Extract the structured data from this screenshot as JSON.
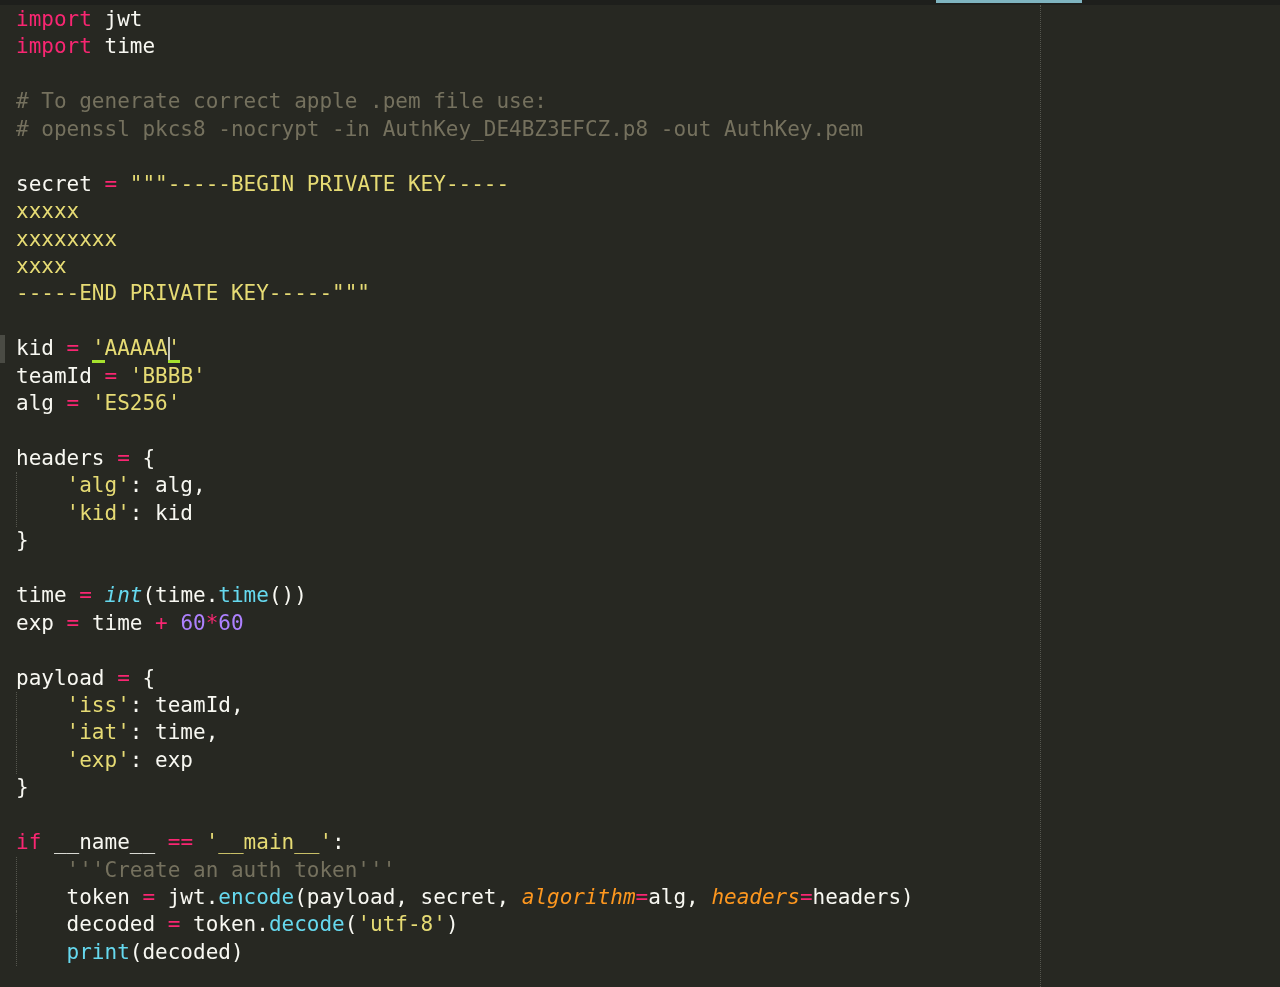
{
  "editor": {
    "lines": [
      {
        "kind": "code",
        "current": false,
        "indented": false,
        "tokens": [
          {
            "kind": "keyword",
            "text": "import"
          },
          {
            "kind": "plain",
            "text": " jwt"
          }
        ]
      },
      {
        "kind": "code",
        "current": false,
        "indented": false,
        "tokens": [
          {
            "kind": "keyword",
            "text": "import"
          },
          {
            "kind": "plain",
            "text": " time"
          }
        ]
      },
      {
        "kind": "blank"
      },
      {
        "kind": "code",
        "current": false,
        "indented": false,
        "tokens": [
          {
            "kind": "comment",
            "text": "# To generate correct apple .pem file use:"
          }
        ]
      },
      {
        "kind": "code",
        "current": false,
        "indented": false,
        "tokens": [
          {
            "kind": "comment",
            "text": "# openssl pkcs8 -nocrypt -in AuthKey_DE4BZ3EFCZ.p8 -out AuthKey.pem"
          }
        ]
      },
      {
        "kind": "blank"
      },
      {
        "kind": "code",
        "current": false,
        "indented": false,
        "tokens": [
          {
            "kind": "plain",
            "text": "secret "
          },
          {
            "kind": "operator",
            "text": "= "
          },
          {
            "kind": "string",
            "text": "\"\"\"-----BEGIN PRIVATE KEY-----"
          }
        ]
      },
      {
        "kind": "code",
        "current": false,
        "indented": false,
        "tokens": [
          {
            "kind": "string",
            "text": "xxxxx"
          }
        ]
      },
      {
        "kind": "code",
        "current": false,
        "indented": false,
        "tokens": [
          {
            "kind": "string",
            "text": "xxxxxxxx"
          }
        ]
      },
      {
        "kind": "code",
        "current": false,
        "indented": false,
        "tokens": [
          {
            "kind": "string",
            "text": "xxxx"
          }
        ]
      },
      {
        "kind": "code",
        "current": false,
        "indented": false,
        "tokens": [
          {
            "kind": "string",
            "text": "-----END PRIVATE KEY-----\"\"\""
          }
        ]
      },
      {
        "kind": "blank"
      },
      {
        "kind": "code",
        "current": true,
        "indented": false,
        "tokens": [
          {
            "kind": "plain",
            "text": "kid "
          },
          {
            "kind": "operator",
            "text": "= "
          },
          {
            "kind": "matched-quote",
            "text": "'"
          },
          {
            "kind": "string",
            "text": "AAAAA"
          },
          {
            "kind": "cursor"
          },
          {
            "kind": "matched-quote",
            "text": "'"
          }
        ]
      },
      {
        "kind": "code",
        "current": false,
        "indented": false,
        "tokens": [
          {
            "kind": "plain",
            "text": "teamId "
          },
          {
            "kind": "operator",
            "text": "= "
          },
          {
            "kind": "string",
            "text": "'BBBB'"
          }
        ]
      },
      {
        "kind": "code",
        "current": false,
        "indented": false,
        "tokens": [
          {
            "kind": "plain",
            "text": "alg "
          },
          {
            "kind": "operator",
            "text": "= "
          },
          {
            "kind": "string",
            "text": "'ES256'"
          }
        ]
      },
      {
        "kind": "blank"
      },
      {
        "kind": "code",
        "current": false,
        "indented": false,
        "tokens": [
          {
            "kind": "plain",
            "text": "headers "
          },
          {
            "kind": "operator",
            "text": "="
          },
          {
            "kind": "plain",
            "text": " {"
          }
        ]
      },
      {
        "kind": "code",
        "current": false,
        "indented": true,
        "tokens": [
          {
            "kind": "string",
            "text": "'alg'"
          },
          {
            "kind": "plain",
            "text": ": alg,"
          }
        ]
      },
      {
        "kind": "code",
        "current": false,
        "indented": true,
        "tokens": [
          {
            "kind": "string",
            "text": "'kid'"
          },
          {
            "kind": "plain",
            "text": ": kid"
          }
        ]
      },
      {
        "kind": "code",
        "current": false,
        "indented": false,
        "tokens": [
          {
            "kind": "plain",
            "text": "}"
          }
        ]
      },
      {
        "kind": "blank"
      },
      {
        "kind": "code",
        "current": false,
        "indented": false,
        "tokens": [
          {
            "kind": "plain",
            "text": "time "
          },
          {
            "kind": "operator",
            "text": "= "
          },
          {
            "kind": "builtin",
            "text": "int"
          },
          {
            "kind": "plain",
            "text": "(time."
          },
          {
            "kind": "function",
            "text": "time"
          },
          {
            "kind": "plain",
            "text": "())"
          }
        ]
      },
      {
        "kind": "code",
        "current": false,
        "indented": false,
        "tokens": [
          {
            "kind": "plain",
            "text": "exp "
          },
          {
            "kind": "operator",
            "text": "="
          },
          {
            "kind": "plain",
            "text": " time "
          },
          {
            "kind": "operator",
            "text": "+ "
          },
          {
            "kind": "number",
            "text": "60"
          },
          {
            "kind": "operator",
            "text": "*"
          },
          {
            "kind": "number",
            "text": "60"
          }
        ]
      },
      {
        "kind": "blank"
      },
      {
        "kind": "code",
        "current": false,
        "indented": false,
        "tokens": [
          {
            "kind": "plain",
            "text": "payload "
          },
          {
            "kind": "operator",
            "text": "="
          },
          {
            "kind": "plain",
            "text": " {"
          }
        ]
      },
      {
        "kind": "code",
        "current": false,
        "indented": true,
        "tokens": [
          {
            "kind": "string",
            "text": "'iss'"
          },
          {
            "kind": "plain",
            "text": ": teamId,"
          }
        ]
      },
      {
        "kind": "code",
        "current": false,
        "indented": true,
        "tokens": [
          {
            "kind": "string",
            "text": "'iat'"
          },
          {
            "kind": "plain",
            "text": ": time,"
          }
        ]
      },
      {
        "kind": "code",
        "current": false,
        "indented": true,
        "tokens": [
          {
            "kind": "string",
            "text": "'exp'"
          },
          {
            "kind": "plain",
            "text": ": exp"
          }
        ]
      },
      {
        "kind": "code",
        "current": false,
        "indented": false,
        "tokens": [
          {
            "kind": "plain",
            "text": "}"
          }
        ]
      },
      {
        "kind": "blank"
      },
      {
        "kind": "code",
        "current": false,
        "indented": false,
        "tokens": [
          {
            "kind": "keyword",
            "text": "if"
          },
          {
            "kind": "plain",
            "text": " __name__ "
          },
          {
            "kind": "operator",
            "text": "== "
          },
          {
            "kind": "string",
            "text": "'__main__'"
          },
          {
            "kind": "plain",
            "text": ":"
          }
        ]
      },
      {
        "kind": "code",
        "current": false,
        "indented": true,
        "tokens": [
          {
            "kind": "comment",
            "text": "'''Create an auth token'''"
          }
        ]
      },
      {
        "kind": "code",
        "current": false,
        "indented": true,
        "tokens": [
          {
            "kind": "plain",
            "text": "token "
          },
          {
            "kind": "operator",
            "text": "="
          },
          {
            "kind": "plain",
            "text": " jwt."
          },
          {
            "kind": "function",
            "text": "encode"
          },
          {
            "kind": "plain",
            "text": "(payload, secret, "
          },
          {
            "kind": "parameter",
            "text": "algorithm"
          },
          {
            "kind": "operator",
            "text": "="
          },
          {
            "kind": "plain",
            "text": "alg, "
          },
          {
            "kind": "parameter",
            "text": "headers"
          },
          {
            "kind": "operator",
            "text": "="
          },
          {
            "kind": "plain",
            "text": "headers)"
          }
        ]
      },
      {
        "kind": "code",
        "current": false,
        "indented": true,
        "tokens": [
          {
            "kind": "plain",
            "text": "decoded "
          },
          {
            "kind": "operator",
            "text": "="
          },
          {
            "kind": "plain",
            "text": " token."
          },
          {
            "kind": "function",
            "text": "decode"
          },
          {
            "kind": "plain",
            "text": "("
          },
          {
            "kind": "string",
            "text": "'utf-8'"
          },
          {
            "kind": "plain",
            "text": ")"
          }
        ]
      },
      {
        "kind": "code",
        "current": false,
        "indented": true,
        "tokens": [
          {
            "kind": "function",
            "text": "print"
          },
          {
            "kind": "plain",
            "text": "(decoded)"
          }
        ]
      }
    ]
  }
}
